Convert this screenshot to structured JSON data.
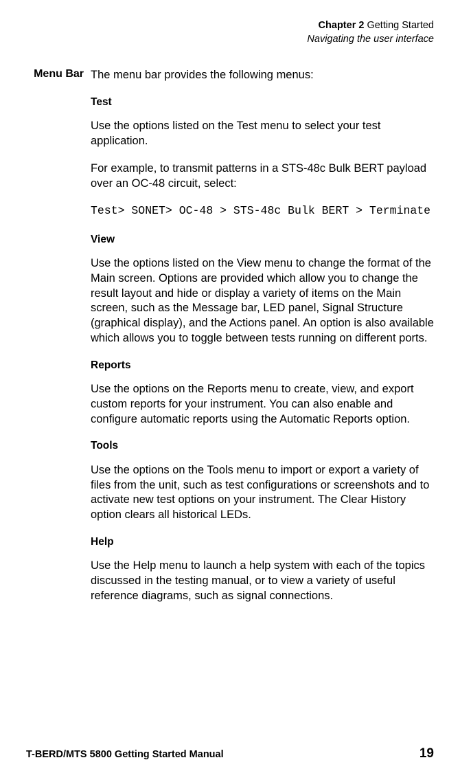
{
  "header": {
    "chapter_label": "Chapter 2",
    "chapter_title": "Getting Started",
    "subtitle": "Navigating the user interface"
  },
  "side_heading": "Menu Bar",
  "intro": "The menu bar provides the following menus:",
  "sections": {
    "test": {
      "heading": "Test",
      "p1": "Use the options listed on the Test menu to select your test application.",
      "p2": "For example, to transmit patterns in a STS-48c Bulk BERT payload over an OC-48 circuit, select:",
      "code": "Test> SONET> OC-48 > STS-48c Bulk BERT > Terminate"
    },
    "view": {
      "heading": "View",
      "p1": "Use the options listed on the View menu to change the format of the Main screen. Options are provided which allow you to change the result layout and hide or display a variety of items on the Main screen, such as the Message bar, LED panel, Signal Structure (graphical display), and the Actions panel. An option is also available which allows you to toggle between tests running on different ports."
    },
    "reports": {
      "heading": "Reports",
      "p1": "Use the options on the Reports menu to create, view, and export custom reports for your instrument. You can also enable and configure automatic reports using the Automatic Reports option."
    },
    "tools": {
      "heading": "Tools",
      "p1": "Use the options on the Tools menu to import or export a variety of files from the unit, such as test configurations or screenshots and to activate new test options on your instru­ment. The Clear History option clears all historical LEDs."
    },
    "help": {
      "heading": "Help",
      "p1": "Use the Help menu to launch a help system with each of the topics discussed in the testing manual, or to view a variety of useful reference diagrams, such as signal connections."
    }
  },
  "footer": {
    "left": "T-BERD/MTS 5800 Getting Started Manual",
    "right": "19"
  }
}
